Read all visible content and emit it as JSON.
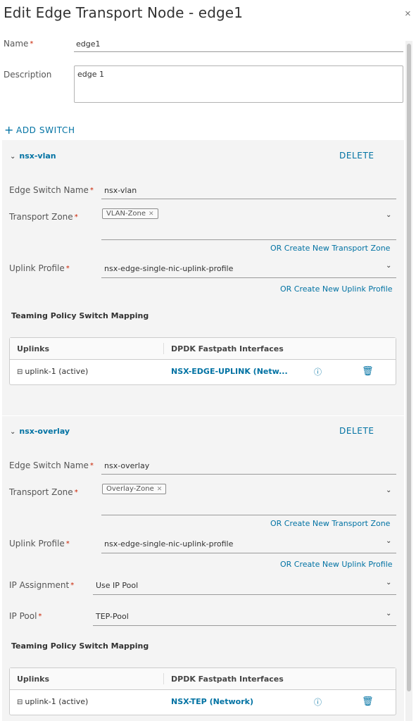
{
  "dialog": {
    "title": "Edit Edge Transport Node - edge1",
    "close_glyph": "×",
    "name_label": "Name",
    "name_value": "edge1",
    "description_label": "Description",
    "description_value": "edge 1",
    "add_switch": "ADD SWITCH",
    "required_mark": "*"
  },
  "switches": [
    {
      "title": "nsx-vlan",
      "delete": "DELETE",
      "edge_switch_name_label": "Edge Switch Name",
      "edge_switch_name": "nsx-vlan",
      "transport_zone_label": "Transport Zone",
      "transport_zone_tag": "VLAN-Zone",
      "create_tz_link": "OR Create New Transport Zone",
      "uplink_profile_label": "Uplink Profile",
      "uplink_profile": "nsx-edge-single-nic-uplink-profile",
      "create_uplink_link": "OR Create New Uplink Profile",
      "teaming_title": "Teaming Policy Switch Mapping",
      "table_headers": [
        "Uplinks",
        "DPDK Fastpath Interfaces"
      ],
      "rows": [
        {
          "uplink": "uplink-1 (active)",
          "interface": "NSX-EDGE-UPLINK (Netw..."
        }
      ]
    },
    {
      "title": "nsx-overlay",
      "delete": "DELETE",
      "edge_switch_name_label": "Edge Switch Name",
      "edge_switch_name": "nsx-overlay",
      "transport_zone_label": "Transport Zone",
      "transport_zone_tag": "Overlay-Zone",
      "create_tz_link": "OR Create New Transport Zone",
      "uplink_profile_label": "Uplink Profile",
      "uplink_profile": "nsx-edge-single-nic-uplink-profile",
      "create_uplink_link": "OR Create New Uplink Profile",
      "ip_assignment_label": "IP Assignment",
      "ip_assignment": "Use IP Pool",
      "ip_pool_label": "IP Pool",
      "ip_pool": "TEP-Pool",
      "teaming_title": "Teaming Policy Switch Mapping",
      "table_headers": [
        "Uplinks",
        "DPDK Fastpath Interfaces"
      ],
      "rows": [
        {
          "uplink": "uplink-1 (active)",
          "interface": "NSX-TEP (Network)"
        }
      ]
    }
  ],
  "icons": {
    "plus": "plus-icon",
    "chevron_down": "chevron-down-icon",
    "collapse": "collapse-chevron-icon",
    "uplink": "uplink-port-icon",
    "info": "info-icon",
    "trash": "trash-icon"
  },
  "colors": {
    "accent": "#0072a3",
    "required": "#c92100",
    "panel_bg": "#f4f4f4"
  }
}
